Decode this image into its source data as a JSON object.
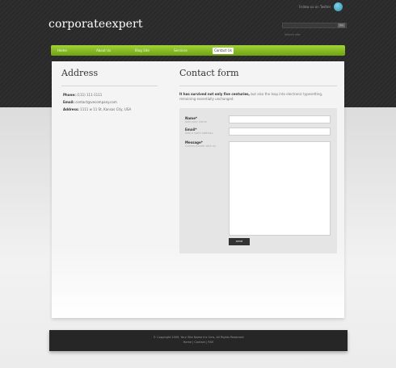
{
  "header": {
    "twitter_text": "Follow us on Twitter",
    "logo": "corporateexpert",
    "search": {
      "placeholder": "Search site",
      "button_label": "Go"
    }
  },
  "nav": {
    "items": [
      {
        "label": "Home"
      },
      {
        "label": "About Us"
      },
      {
        "label": "Blog Site"
      },
      {
        "label": "Services"
      },
      {
        "label": "Contact Us",
        "active": true
      }
    ]
  },
  "address": {
    "title": "Address",
    "phone_label": "Phone:",
    "phone_value": "(111) 111-1111",
    "email_label": "Email:",
    "email_value": "contact@vecompany.com",
    "address_label": "Address:",
    "address_value": "1111 w 11 St, Kansas City, USA"
  },
  "contact": {
    "title": "Contact form",
    "intro_bold": "It has survived not only five centuries,",
    "intro_rest": " but also the leap into electronic typesetting, remaining essentially unchanged.",
    "fields": {
      "name_label": "Name*",
      "name_hint": "Add your name",
      "email_label": "Email*",
      "email_hint": "Add a valid address",
      "message_label": "Message*",
      "message_hint": "Communicate with us"
    },
    "send_label": "send"
  },
  "footer": {
    "copyright": "© Copyright 2009, Your Site Name Inc Cms, All Rights Reserved",
    "links": "Home | Contact | RSS"
  },
  "colors": {
    "nav_green_top": "#a3d338",
    "nav_green_bottom": "#6ea311",
    "dark_band": "#2c2c2c",
    "footer_bg": "#262626",
    "twitter_icon": "#2f8fb0"
  }
}
